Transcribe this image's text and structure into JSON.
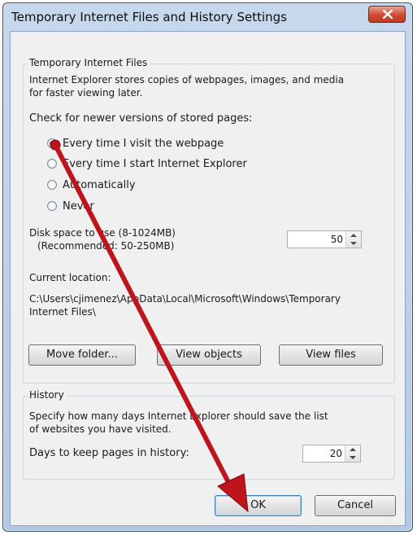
{
  "window": {
    "title": "Temporary Internet Files and History Settings",
    "close_label": "x"
  },
  "temp_files": {
    "group_label": "Temporary Internet Files",
    "description_line1": "Internet Explorer stores copies of webpages, images, and media",
    "description_line2": "for faster viewing later.",
    "check_label": "Check for newer versions of stored pages:",
    "options": [
      {
        "label": "Every time I visit the webpage",
        "checked": true
      },
      {
        "label": "Every time I start Internet Explorer",
        "checked": false
      },
      {
        "label": "Automatically",
        "checked": false
      },
      {
        "label": "Never",
        "checked": false
      }
    ],
    "disk_space_label1": "Disk space to use (8-1024MB)",
    "disk_space_label2": "(Recommended: 50-250MB)",
    "disk_space_value": "50",
    "current_location_label": "Current location:",
    "location_line1": "C:\\Users\\cjimenez\\AppData\\Local\\Microsoft\\Windows\\Temporary",
    "location_line2": "Internet Files\\",
    "buttons": {
      "move_folder": "Move folder...",
      "view_objects": "View objects",
      "view_files": "View files"
    }
  },
  "history": {
    "group_label": "History",
    "description_line1": "Specify how many days Internet Explorer should save the list",
    "description_line2": "of websites you have visited.",
    "days_label": "Days to keep pages in history:",
    "days_value": "20"
  },
  "footer": {
    "ok_label": "OK",
    "cancel_label": "Cancel"
  },
  "annotation": {
    "arrow_color": "#c0141c"
  }
}
